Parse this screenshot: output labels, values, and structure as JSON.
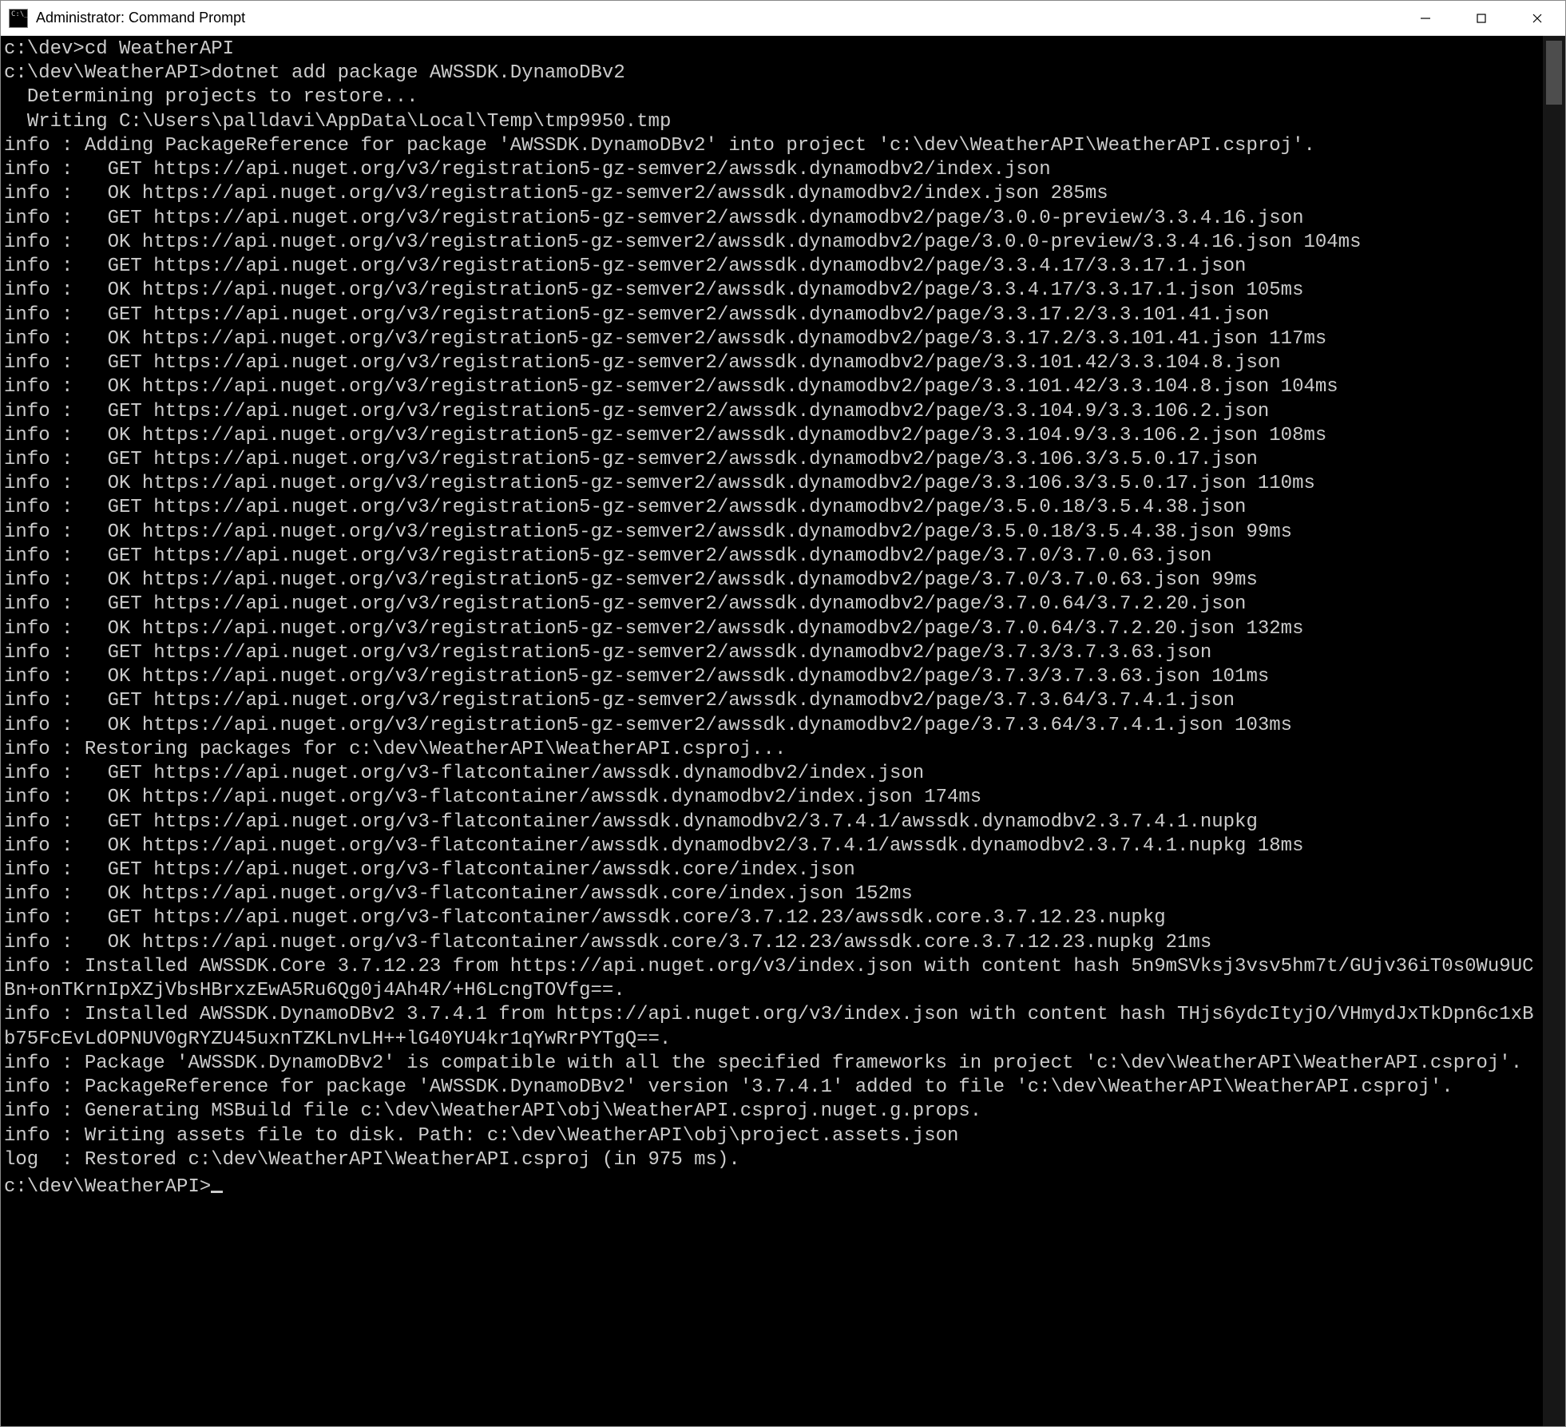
{
  "window": {
    "title": "Administrator: Command Prompt"
  },
  "terminal": {
    "lines": [
      "c:\\dev>cd WeatherAPI",
      "",
      "c:\\dev\\WeatherAPI>dotnet add package AWSSDK.DynamoDBv2",
      "  Determining projects to restore...",
      "  Writing C:\\Users\\palldavi\\AppData\\Local\\Temp\\tmp9950.tmp",
      "info : Adding PackageReference for package 'AWSSDK.DynamoDBv2' into project 'c:\\dev\\WeatherAPI\\WeatherAPI.csproj'.",
      "info :   GET https://api.nuget.org/v3/registration5-gz-semver2/awssdk.dynamodbv2/index.json",
      "info :   OK https://api.nuget.org/v3/registration5-gz-semver2/awssdk.dynamodbv2/index.json 285ms",
      "info :   GET https://api.nuget.org/v3/registration5-gz-semver2/awssdk.dynamodbv2/page/3.0.0-preview/3.3.4.16.json",
      "info :   OK https://api.nuget.org/v3/registration5-gz-semver2/awssdk.dynamodbv2/page/3.0.0-preview/3.3.4.16.json 104ms",
      "info :   GET https://api.nuget.org/v3/registration5-gz-semver2/awssdk.dynamodbv2/page/3.3.4.17/3.3.17.1.json",
      "info :   OK https://api.nuget.org/v3/registration5-gz-semver2/awssdk.dynamodbv2/page/3.3.4.17/3.3.17.1.json 105ms",
      "info :   GET https://api.nuget.org/v3/registration5-gz-semver2/awssdk.dynamodbv2/page/3.3.17.2/3.3.101.41.json",
      "info :   OK https://api.nuget.org/v3/registration5-gz-semver2/awssdk.dynamodbv2/page/3.3.17.2/3.3.101.41.json 117ms",
      "info :   GET https://api.nuget.org/v3/registration5-gz-semver2/awssdk.dynamodbv2/page/3.3.101.42/3.3.104.8.json",
      "info :   OK https://api.nuget.org/v3/registration5-gz-semver2/awssdk.dynamodbv2/page/3.3.101.42/3.3.104.8.json 104ms",
      "info :   GET https://api.nuget.org/v3/registration5-gz-semver2/awssdk.dynamodbv2/page/3.3.104.9/3.3.106.2.json",
      "info :   OK https://api.nuget.org/v3/registration5-gz-semver2/awssdk.dynamodbv2/page/3.3.104.9/3.3.106.2.json 108ms",
      "info :   GET https://api.nuget.org/v3/registration5-gz-semver2/awssdk.dynamodbv2/page/3.3.106.3/3.5.0.17.json",
      "info :   OK https://api.nuget.org/v3/registration5-gz-semver2/awssdk.dynamodbv2/page/3.3.106.3/3.5.0.17.json 110ms",
      "info :   GET https://api.nuget.org/v3/registration5-gz-semver2/awssdk.dynamodbv2/page/3.5.0.18/3.5.4.38.json",
      "info :   OK https://api.nuget.org/v3/registration5-gz-semver2/awssdk.dynamodbv2/page/3.5.0.18/3.5.4.38.json 99ms",
      "info :   GET https://api.nuget.org/v3/registration5-gz-semver2/awssdk.dynamodbv2/page/3.7.0/3.7.0.63.json",
      "info :   OK https://api.nuget.org/v3/registration5-gz-semver2/awssdk.dynamodbv2/page/3.7.0/3.7.0.63.json 99ms",
      "info :   GET https://api.nuget.org/v3/registration5-gz-semver2/awssdk.dynamodbv2/page/3.7.0.64/3.7.2.20.json",
      "info :   OK https://api.nuget.org/v3/registration5-gz-semver2/awssdk.dynamodbv2/page/3.7.0.64/3.7.2.20.json 132ms",
      "info :   GET https://api.nuget.org/v3/registration5-gz-semver2/awssdk.dynamodbv2/page/3.7.3/3.7.3.63.json",
      "info :   OK https://api.nuget.org/v3/registration5-gz-semver2/awssdk.dynamodbv2/page/3.7.3/3.7.3.63.json 101ms",
      "info :   GET https://api.nuget.org/v3/registration5-gz-semver2/awssdk.dynamodbv2/page/3.7.3.64/3.7.4.1.json",
      "info :   OK https://api.nuget.org/v3/registration5-gz-semver2/awssdk.dynamodbv2/page/3.7.3.64/3.7.4.1.json 103ms",
      "info : Restoring packages for c:\\dev\\WeatherAPI\\WeatherAPI.csproj...",
      "info :   GET https://api.nuget.org/v3-flatcontainer/awssdk.dynamodbv2/index.json",
      "info :   OK https://api.nuget.org/v3-flatcontainer/awssdk.dynamodbv2/index.json 174ms",
      "info :   GET https://api.nuget.org/v3-flatcontainer/awssdk.dynamodbv2/3.7.4.1/awssdk.dynamodbv2.3.7.4.1.nupkg",
      "info :   OK https://api.nuget.org/v3-flatcontainer/awssdk.dynamodbv2/3.7.4.1/awssdk.dynamodbv2.3.7.4.1.nupkg 18ms",
      "info :   GET https://api.nuget.org/v3-flatcontainer/awssdk.core/index.json",
      "info :   OK https://api.nuget.org/v3-flatcontainer/awssdk.core/index.json 152ms",
      "info :   GET https://api.nuget.org/v3-flatcontainer/awssdk.core/3.7.12.23/awssdk.core.3.7.12.23.nupkg",
      "info :   OK https://api.nuget.org/v3-flatcontainer/awssdk.core/3.7.12.23/awssdk.core.3.7.12.23.nupkg 21ms",
      "info : Installed AWSSDK.Core 3.7.12.23 from https://api.nuget.org/v3/index.json with content hash 5n9mSVksj3vsv5hm7t/GUjv36iT0s0Wu9UCBn+onTKrnIpXZjVbsHBrxzEwA5Ru6Qg0j4Ah4R/+H6LcngTOVfg==.",
      "info : Installed AWSSDK.DynamoDBv2 3.7.4.1 from https://api.nuget.org/v3/index.json with content hash THjs6ydcItyjO/VHmydJxTkDpn6c1xBb75FcEvLdOPNUV0gRYZU45uxnTZKLnvLH++lG40YU4kr1qYwRrPYTgQ==.",
      "info : Package 'AWSSDK.DynamoDBv2' is compatible with all the specified frameworks in project 'c:\\dev\\WeatherAPI\\WeatherAPI.csproj'.",
      "info : PackageReference for package 'AWSSDK.DynamoDBv2' version '3.7.4.1' added to file 'c:\\dev\\WeatherAPI\\WeatherAPI.csproj'.",
      "info : Generating MSBuild file c:\\dev\\WeatherAPI\\obj\\WeatherAPI.csproj.nuget.g.props.",
      "info : Writing assets file to disk. Path: c:\\dev\\WeatherAPI\\obj\\project.assets.json",
      "log  : Restored c:\\dev\\WeatherAPI\\WeatherAPI.csproj (in 975 ms).",
      "",
      "c:\\dev\\WeatherAPI>"
    ]
  }
}
